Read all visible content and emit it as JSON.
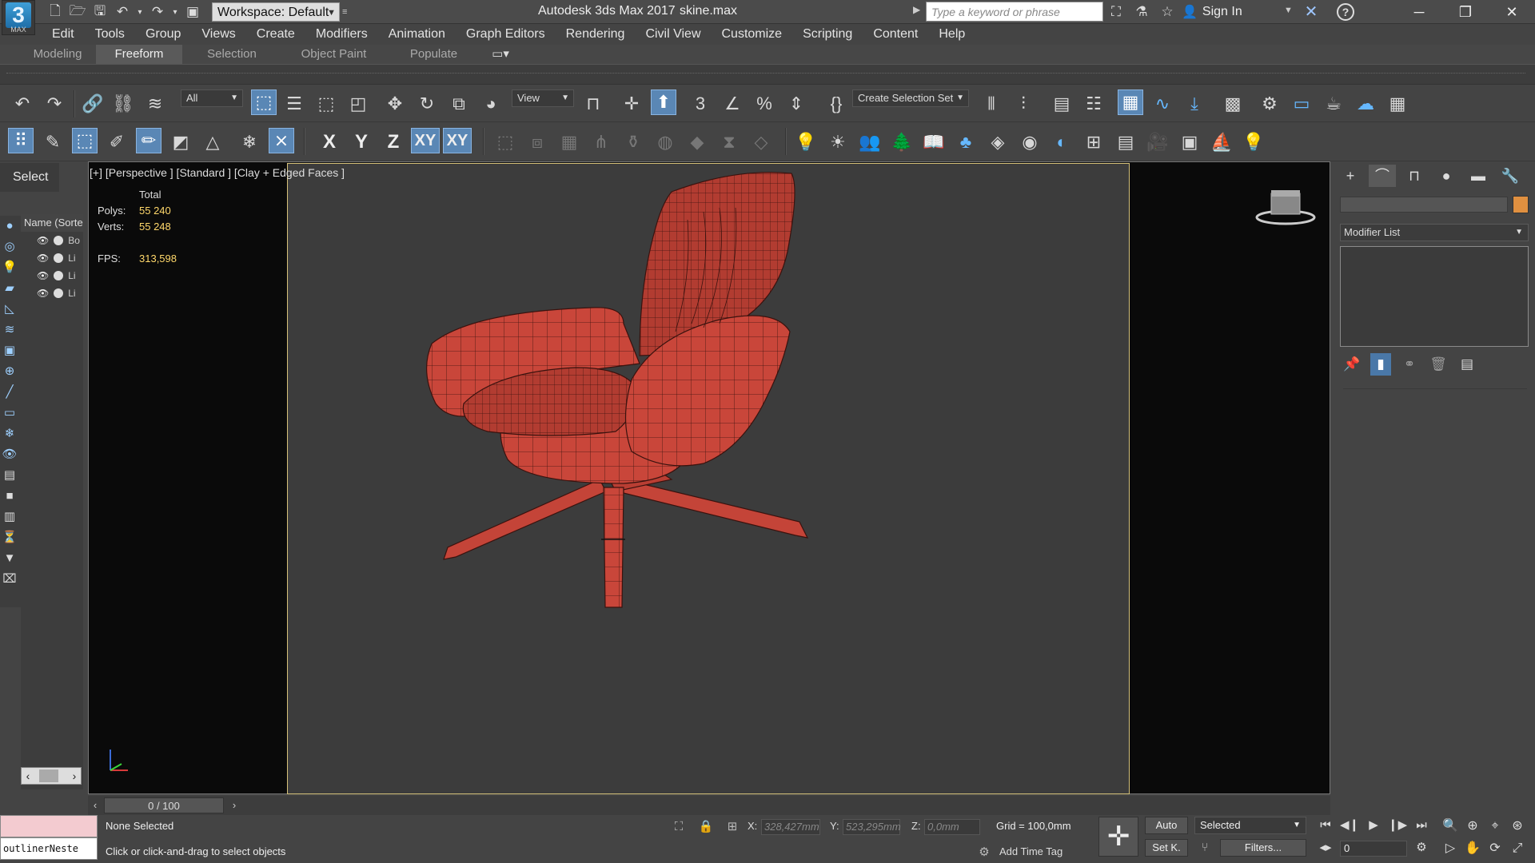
{
  "titlebar": {
    "app_logo_number": "3",
    "app_logo_text": "MAX",
    "workspace": "Workspace: Default",
    "app_title": "Autodesk 3ds Max 2017",
    "file_name": "skine.max",
    "search_placeholder": "Type a keyword or phrase",
    "sign_in": "Sign In"
  },
  "menu": [
    "Edit",
    "Tools",
    "Group",
    "Views",
    "Create",
    "Modifiers",
    "Animation",
    "Graph Editors",
    "Rendering",
    "Civil View",
    "Customize",
    "Scripting",
    "Content",
    "Help"
  ],
  "ribbon_tabs": [
    "Modeling",
    "Freeform",
    "Selection",
    "Object Paint",
    "Populate"
  ],
  "ribbon_active_tab": "Freeform",
  "toolbar": {
    "selection_filter": "All",
    "reference_coord": "View",
    "named_selection_set": "Create Selection Set",
    "axis_x": "X",
    "axis_y": "Y",
    "axis_z": "Z",
    "axis_xy": "XY",
    "axis_xy2": "XY"
  },
  "left_panel": {
    "select_label": "Select",
    "explorer_header": "Name (Sorted Ascending)",
    "items": [
      {
        "name": "Bo"
      },
      {
        "name": "Li"
      },
      {
        "name": "Li"
      },
      {
        "name": "Li"
      }
    ]
  },
  "viewport": {
    "label": "[+] [Perspective ] [Standard ] [Clay + Edged Faces ]",
    "stats": {
      "header": "Total",
      "polys_label": "Polys:",
      "polys_value": "55 240",
      "verts_label": "Verts:",
      "verts_value": "55 248",
      "fps_label": "FPS:",
      "fps_value": "313,598"
    },
    "model_color": "#c9463a",
    "wire_color": "#3a120e"
  },
  "command_panel": {
    "modifier_list": "Modifier List",
    "object_color": "#e09040"
  },
  "timeline": {
    "slider": "0 / 100"
  },
  "statusbar": {
    "maxscript_input": "outlinerNeste",
    "selection_status": "None Selected",
    "prompt": "Click or click-and-drag to select objects",
    "x_label": "X:",
    "x_value": "328,427mm",
    "y_label": "Y:",
    "y_value": "523,295mm",
    "z_label": "Z:",
    "z_value": "0,0mm",
    "grid": "Grid = 100,0mm",
    "add_time_tag": "Add Time Tag",
    "auto_key": "Auto",
    "set_key": "Set K.",
    "key_filter_selected": "Selected",
    "filters": "Filters...",
    "current_frame": "0"
  }
}
